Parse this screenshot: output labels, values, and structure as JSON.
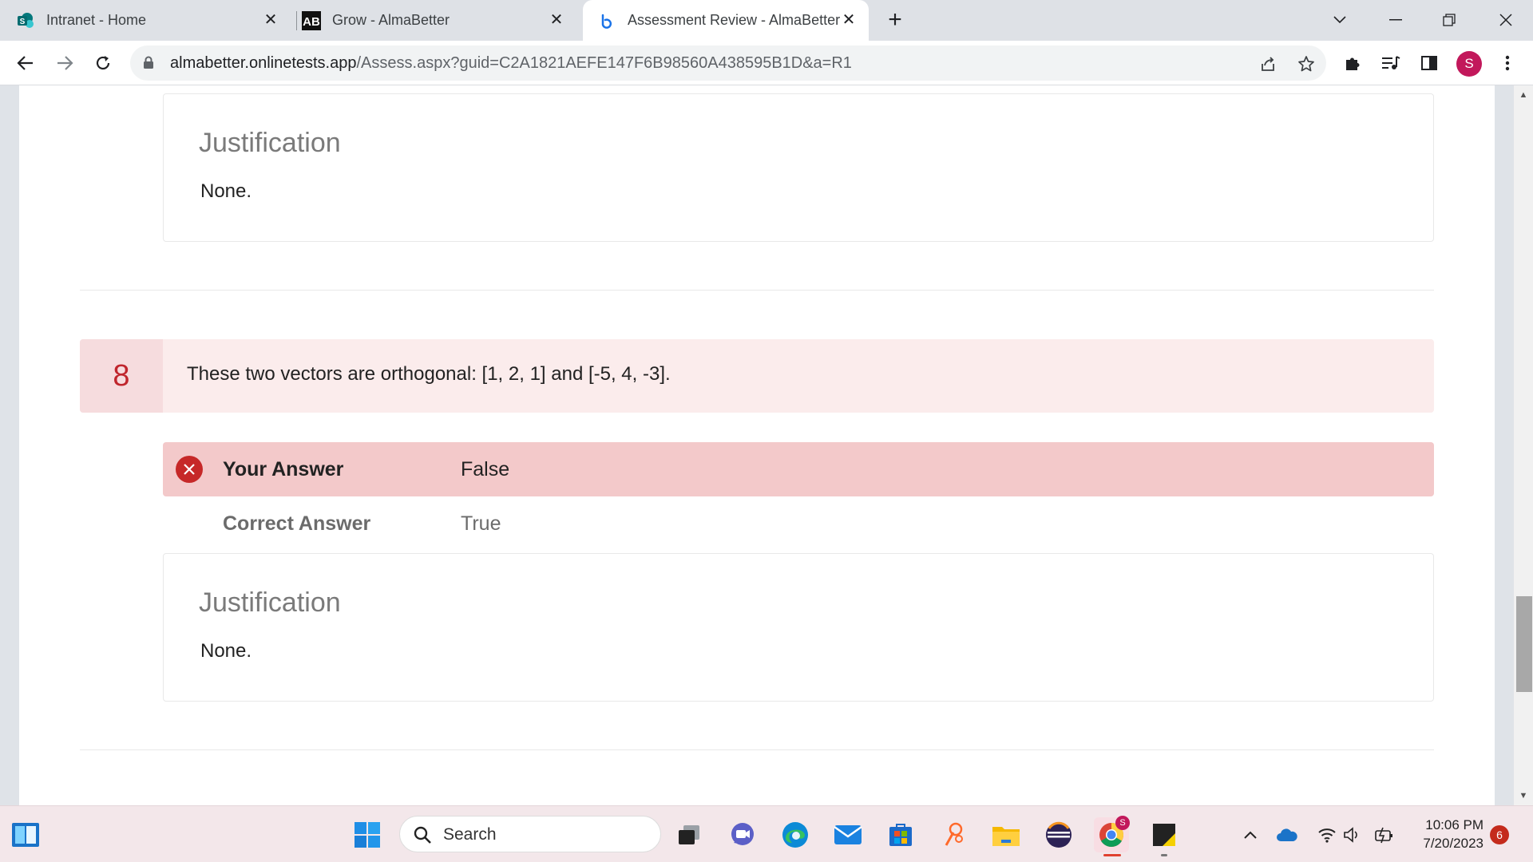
{
  "browser": {
    "tabs": [
      {
        "title": "Intranet - Home",
        "icon": "sharepoint-icon"
      },
      {
        "title": "Grow - AlmaBetter",
        "icon": "almabetter-ab-icon"
      },
      {
        "title": "Assessment Review - AlmaBetter",
        "icon": "loading-icon",
        "active": true
      }
    ],
    "url_host": "almabetter.onlinetests.app",
    "url_path": "/Assess.aspx?guid=C2A1821AEFE147F6B98560A438595B1D&a=R1",
    "profile_initial": "S"
  },
  "page": {
    "prev_justification": {
      "title": "Justification",
      "body": "None."
    },
    "question": {
      "number": "8",
      "text": "These two vectors are orthogonal: [1, 2, 1] and [-5, 4, -3]."
    },
    "your_answer": {
      "label": "Your Answer",
      "value": "False"
    },
    "correct_answer": {
      "label": "Correct Answer",
      "value": "True"
    },
    "justification": {
      "title": "Justification",
      "body": "None."
    }
  },
  "taskbar": {
    "search_placeholder": "Search",
    "time": "10:06 PM",
    "date": "7/20/2023",
    "notification_count": "6",
    "chrome_badge": "S"
  },
  "colors": {
    "question_bg": "#fbecec",
    "question_number": "#c0262d",
    "wrong_answer_bg": "#f3c9ca",
    "wrong_icon": "#c62828"
  }
}
